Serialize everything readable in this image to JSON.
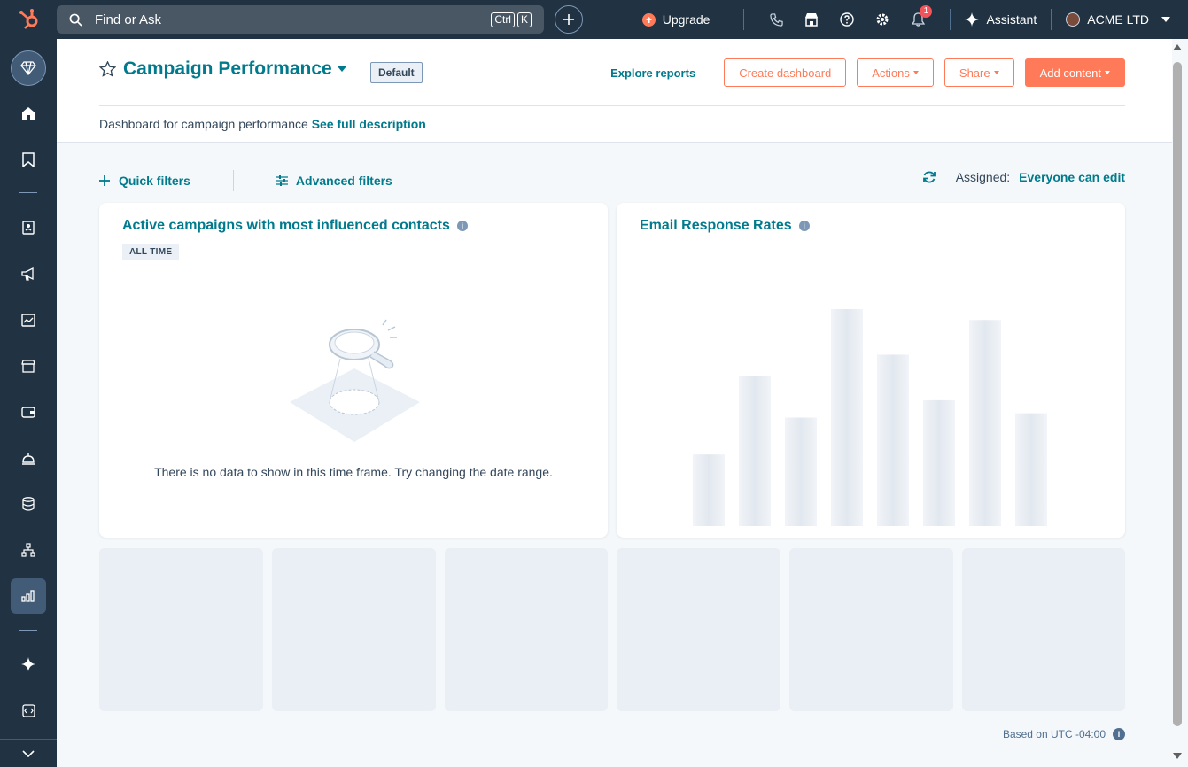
{
  "topbar": {
    "search_placeholder": "Find or Ask",
    "kbd_ctrl": "Ctrl",
    "kbd_k": "K",
    "upgrade_label": "Upgrade",
    "notification_count": "1",
    "assistant_label": "Assistant",
    "account_name": "ACME LTD"
  },
  "header": {
    "title": "Campaign Performance",
    "default_tag": "Default",
    "explore_label": "Explore reports",
    "create_dashboard_label": "Create dashboard",
    "actions_label": "Actions",
    "share_label": "Share",
    "add_content_label": "Add content",
    "description": "Dashboard for campaign performance",
    "see_full_description": "See full description"
  },
  "filters": {
    "quick_filters": "Quick filters",
    "advanced_filters": "Advanced filters",
    "assigned_label": "Assigned:",
    "assigned_value": "Everyone can edit"
  },
  "cards": {
    "card1": {
      "title": "Active campaigns with most influenced contacts",
      "time_tag": "ALL TIME",
      "empty_message": "There is no data to show in this time frame. Try changing the date range."
    },
    "card2": {
      "title": "Email Response Rates",
      "placeholder_bars": [
        0.33,
        0.69,
        0.5,
        1.0,
        0.79,
        0.58,
        0.95,
        0.52
      ]
    }
  },
  "footer": {
    "timezone": "Based on UTC -04:00"
  },
  "colors": {
    "accent": "#007a8c",
    "primary_button": "#ff7a59",
    "topbar": "#213343"
  }
}
